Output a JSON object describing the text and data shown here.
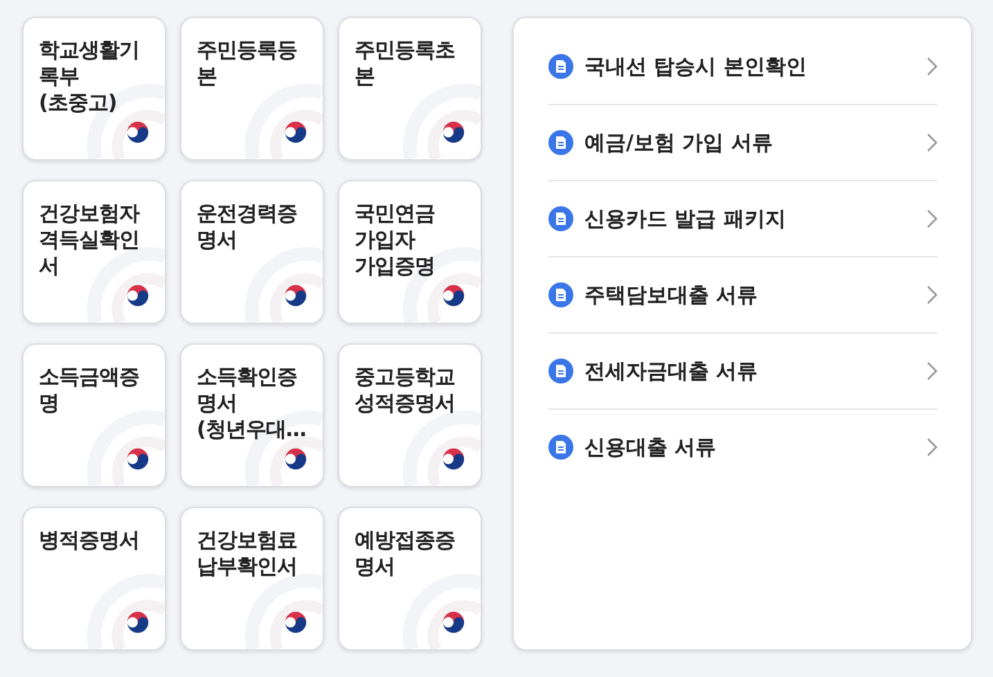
{
  "cards": [
    {
      "lines": [
        "학교생활기",
        "록부",
        "(초중고)"
      ]
    },
    {
      "lines": [
        "주민등록등",
        "본"
      ]
    },
    {
      "lines": [
        "주민등록초",
        "본"
      ]
    },
    {
      "lines": [
        "건강보험자",
        "격득실확인",
        "서"
      ]
    },
    {
      "lines": [
        "운전경력증",
        "명서"
      ]
    },
    {
      "lines": [
        "국민연금",
        "가입자",
        "가입증명"
      ]
    },
    {
      "lines": [
        "소득금액증",
        "명"
      ]
    },
    {
      "lines": [
        "소득확인증",
        "명서",
        "(청년우대…"
      ]
    },
    {
      "lines": [
        "중고등학교",
        "성적증명서"
      ]
    },
    {
      "lines": [
        "병적증명서"
      ]
    },
    {
      "lines": [
        "건강보험료",
        "납부확인서"
      ]
    },
    {
      "lines": [
        "예방접종증",
        "명서"
      ]
    }
  ],
  "packages": [
    {
      "label": "국내선 탑승시 본인확인"
    },
    {
      "label": "예금/보험 가입 서류"
    },
    {
      "label": "신용카드 발급 패키지"
    },
    {
      "label": "주택담보대출 서류"
    },
    {
      "label": "전세자금대출 서류"
    },
    {
      "label": "신용대출 서류"
    }
  ]
}
